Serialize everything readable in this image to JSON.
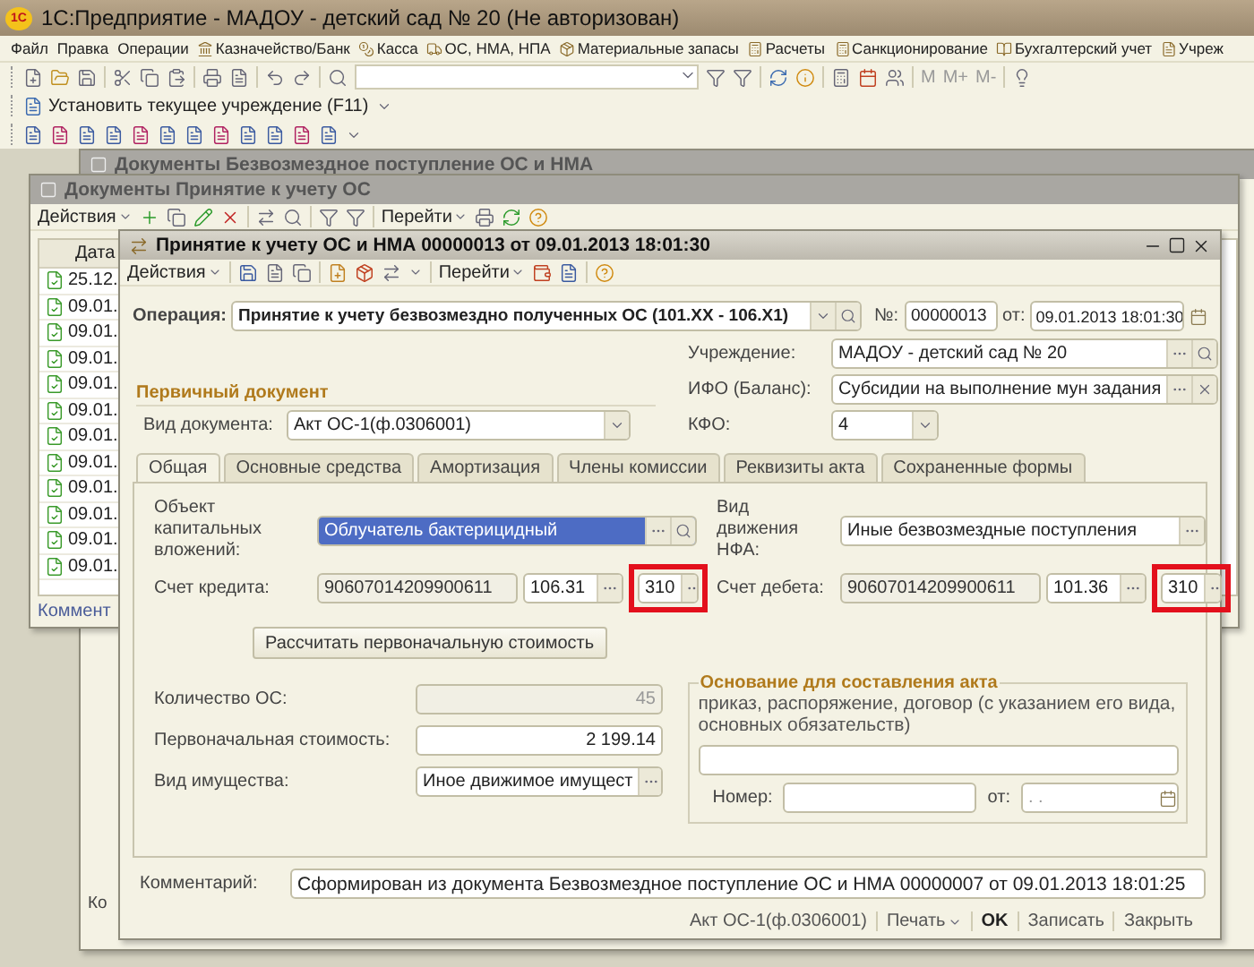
{
  "app": {
    "logo": "1С",
    "title": "1С:Предприятие - МАДОУ - детский сад № 20 (Не авторизован)"
  },
  "menu": [
    {
      "label": "Файл",
      "has_icon": false
    },
    {
      "label": "Правка",
      "has_icon": false
    },
    {
      "label": "Операции",
      "has_icon": false
    },
    {
      "label": "Казначейство/Банк",
      "has_icon": true
    },
    {
      "label": "Касса",
      "has_icon": true
    },
    {
      "label": "ОС, НМА, НПА",
      "has_icon": true
    },
    {
      "label": "Материальные запасы",
      "has_icon": true
    },
    {
      "label": "Расчеты",
      "has_icon": true
    },
    {
      "label": "Санкционирование",
      "has_icon": true
    },
    {
      "label": "Бухгалтерский учет",
      "has_icon": true
    },
    {
      "label": "Учреж",
      "has_icon": true
    }
  ],
  "memory_buttons": [
    "M",
    "M+",
    "M-"
  ],
  "org_button": "Установить текущее учреждение (F11)",
  "back_window": {
    "title": "Документы Безвозмездное поступление ОС и НМА",
    "footer_label": "Ко"
  },
  "list_window": {
    "title": "Документы Принятие к учету ОС",
    "actions": "Действия",
    "goto": "Перейти",
    "column": "Дата",
    "footer_label": "Коммент",
    "rows": [
      {
        "date": "25.12."
      },
      {
        "date": "09.01."
      },
      {
        "date": "09.01."
      },
      {
        "date": "09.01."
      },
      {
        "date": "09.01."
      },
      {
        "date": "09.01."
      },
      {
        "date": "09.01."
      },
      {
        "date": "09.01."
      },
      {
        "date": "09.01."
      },
      {
        "date": "09.01."
      },
      {
        "date": "09.01."
      },
      {
        "date": "09.01."
      }
    ]
  },
  "form": {
    "title": "Принятие к учету ОС и НМА 00000013 от 09.01.2013 18:01:30",
    "actions": "Действия",
    "goto": "Перейти",
    "operation": {
      "label": "Операция:",
      "value": "Принятие к учету безвозмездно полученных ОС  (101.XX - 106.X1)"
    },
    "number": {
      "label": "№:",
      "value": "00000013"
    },
    "date": {
      "label": "от:",
      "value": "09.01.2013 18:01:30"
    },
    "right_fields": [
      {
        "label": "Учреждение:",
        "value": "МАДОУ - детский сад № 20",
        "kind": "search"
      },
      {
        "label": "ИФО (Баланс):",
        "value": "Субсидии на выполнение мун задания",
        "kind": "clear"
      },
      {
        "label": "КФО:",
        "value": "4",
        "kind": "dropdown"
      }
    ],
    "primary_doc": {
      "heading": "Первичный документ",
      "label": "Вид документа:",
      "value": "Акт ОС-1(ф.0306001)"
    },
    "tabs": [
      {
        "label": "Общая",
        "selected": true
      },
      {
        "label": "Основные средства",
        "selected": false
      },
      {
        "label": "Амортизация",
        "selected": false
      },
      {
        "label": "Члены комиссии",
        "selected": false
      },
      {
        "label": "Реквизиты акта",
        "selected": false
      },
      {
        "label": "Сохраненные формы",
        "selected": false
      }
    ],
    "capital_object": {
      "label": "Объект капитальных вложений:",
      "value": "Облучатель бактерицидный",
      "selected": true
    },
    "nfa_movement": {
      "label": "Вид движения НФА:",
      "value": "Иные безвозмездные поступления"
    },
    "accounts": [
      {
        "label": "Счет кредита:",
        "account": "90607014209900611",
        "code": "106.31",
        "kosgu": "310",
        "highlighted": true
      },
      {
        "label": "Счет дебета:",
        "account": "90607014209900611",
        "code": "101.36",
        "kosgu": "310",
        "highlighted": true
      }
    ],
    "calc_button": "Рассчитать первоначальную стоимость",
    "totals": [
      {
        "label": "Количество ОС:",
        "value": "45",
        "kind": "number",
        "disabled": true
      },
      {
        "label": "Первоначальная стоимость:",
        "value": "2 199.14",
        "kind": "number",
        "disabled": false
      },
      {
        "label": "Вид имущества:",
        "value": "Иное движимое имущест",
        "kind": "choice",
        "disabled": false
      }
    ],
    "basis": {
      "heading": "Основание для составления акта",
      "hint": "приказ, распоряжение, договор (с указанием его вида, основных обязательств)",
      "number_label": "Номер:",
      "date_label": "от:",
      "date_value": ". ."
    },
    "comment": {
      "label": "Комментарий:",
      "value": "Сформирован из документа Безвозмездное поступление ОС и НМА 00000007 от 09.01.2013 18:01:25"
    },
    "footer": [
      {
        "label": "Акт ОС-1(ф.0306001)",
        "kind": "link"
      },
      {
        "label": "Печать",
        "kind": "menu"
      },
      {
        "label": "OK",
        "kind": "default"
      },
      {
        "label": "Записать",
        "kind": "link"
      },
      {
        "label": "Закрыть",
        "kind": "link"
      }
    ]
  }
}
